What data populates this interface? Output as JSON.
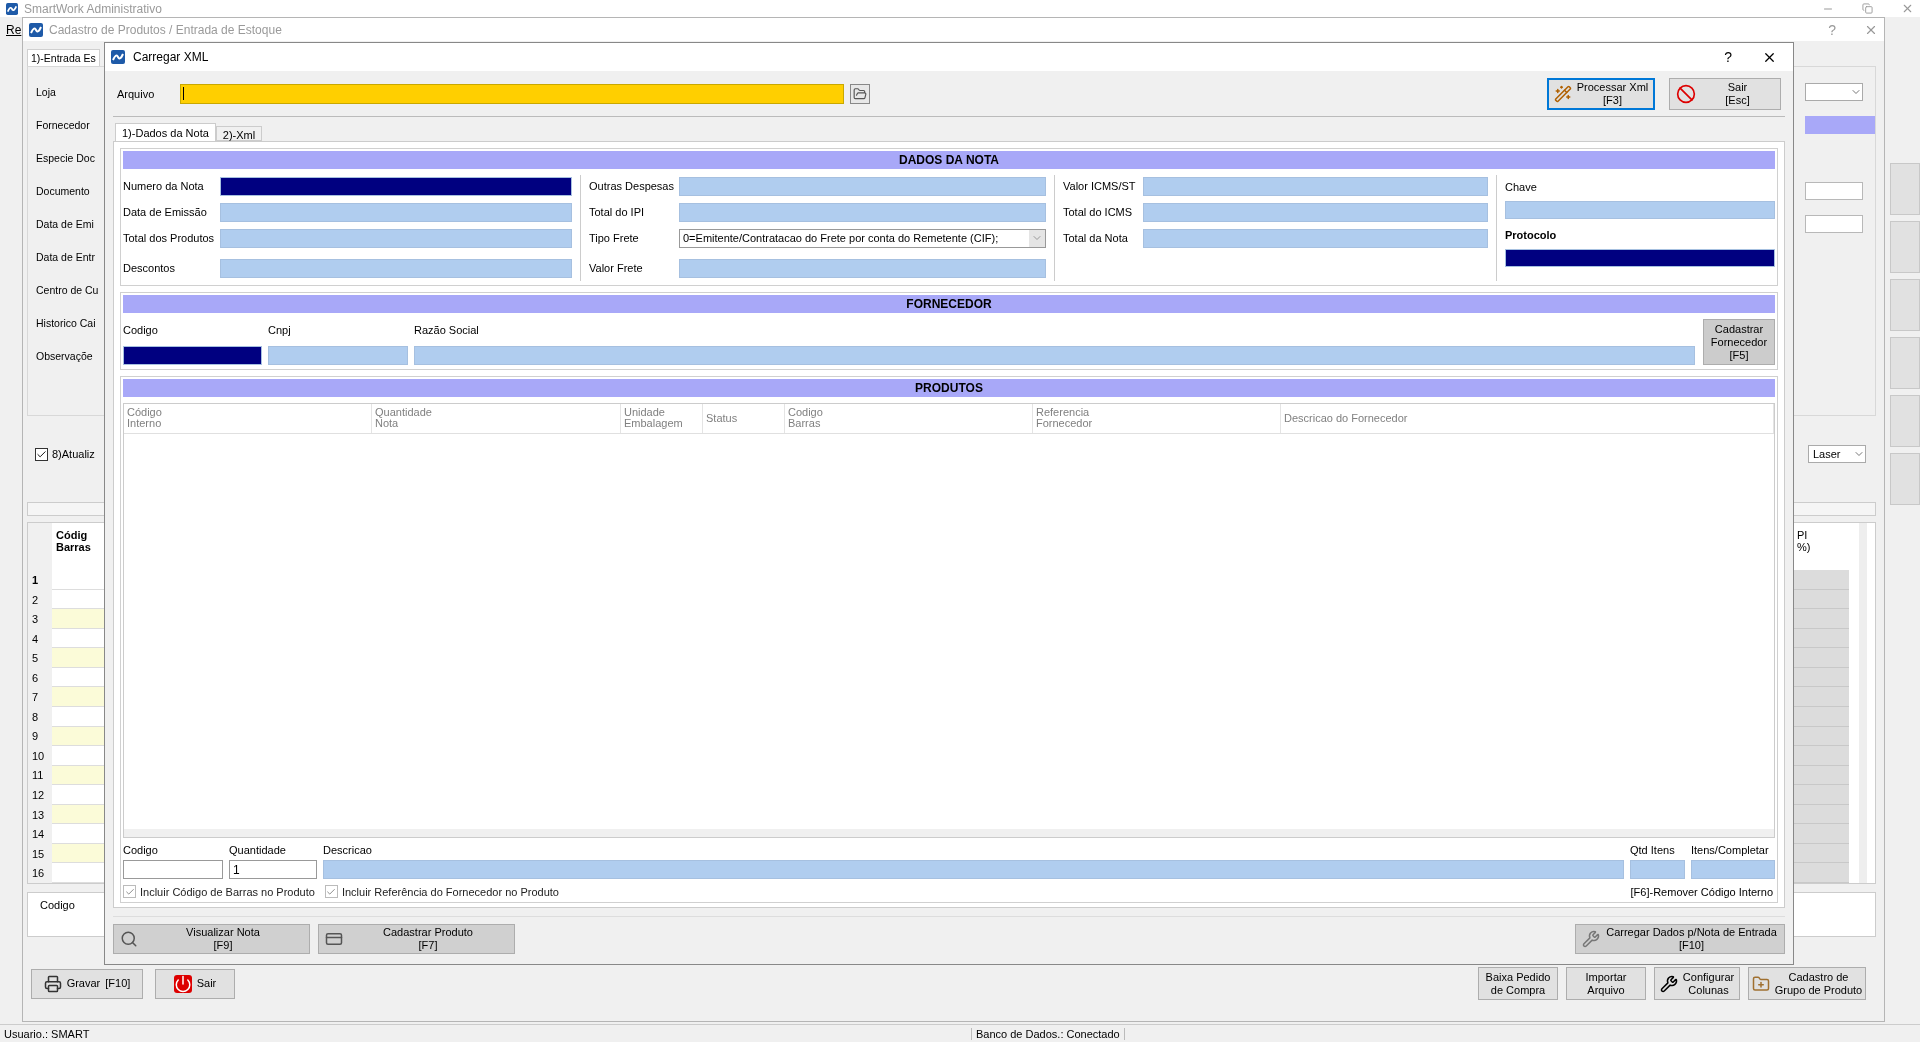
{
  "main_window": {
    "title": "SmartWork Administrativo",
    "menu": [
      "Re"
    ],
    "status_bar": [
      "Usuario.: SMART",
      "Banco de Dados.: Conectado"
    ]
  },
  "cadastro": {
    "title": "Cadastro de Produtos / Entrada de Estoque",
    "help": "?",
    "tab": {
      "label": "1)-Entrada Es",
      "selected": true
    },
    "labels": [
      "Loja",
      "Fornecedor",
      "Especie Doc",
      "Documento",
      "Data de Emi",
      "Data de Entr",
      "Centro de Cu",
      "Historico Cai",
      "Observaçõe"
    ],
    "update_checkbox": {
      "label": "8)Atualiz",
      "checked": true
    },
    "printer_combo": {
      "value": "Laser"
    },
    "grid": {
      "column_1": [
        "Códig",
        "Barras"
      ],
      "column_2": [
        "PI",
        "%)"
      ],
      "rows": [
        {
          "number": "1",
          "selected": true
        },
        {
          "number": "2",
          "selected": false
        },
        {
          "number": "3",
          "selected": false
        },
        {
          "number": "4",
          "selected": false
        },
        {
          "number": "5",
          "selected": false
        },
        {
          "number": "6",
          "selected": false
        },
        {
          "number": "7",
          "selected": false
        },
        {
          "number": "8",
          "selected": false
        },
        {
          "number": "9",
          "selected": false
        },
        {
          "number": "10",
          "selected": false
        },
        {
          "number": "11",
          "selected": false
        },
        {
          "number": "12",
          "selected": false
        },
        {
          "number": "13",
          "selected": false
        },
        {
          "number": "14",
          "selected": false
        },
        {
          "number": "15",
          "selected": false
        },
        {
          "number": "16",
          "selected": false
        }
      ]
    },
    "code_label": "Codigo",
    "buttons": [
      {
        "lines": [
          "Gravar",
          "[F10]"
        ]
      },
      {
        "lines": [
          "Sair"
        ]
      }
    ],
    "right_buttons": [
      {
        "lines": [
          "Baixa Pedido",
          "de Compra"
        ]
      },
      {
        "lines": [
          "Importar",
          "Arquivo"
        ]
      },
      {
        "lines": [
          "Configurar",
          "Colunas"
        ]
      },
      {
        "lines": [
          "Cadastro de",
          "Grupo de Produto"
        ]
      }
    ]
  },
  "dialog": {
    "title": "Carregar XML",
    "help": "?",
    "file_label": "Arquivo",
    "buttons": [
      {
        "lines": [
          "Processar Xml",
          "[F3]"
        ],
        "focused": true
      },
      {
        "lines": [
          "Sair",
          "[Esc]"
        ],
        "focused": false
      }
    ],
    "tabs": [
      {
        "label": "1)-Dados da Nota",
        "selected": true
      },
      {
        "label": "2)-Xml",
        "selected": false
      }
    ],
    "dados": {
      "title": "DADOS DA NOTA",
      "columns": [
        [
          {
            "kind": "field",
            "label": "Numero da Nota",
            "highlighted": true
          },
          {
            "kind": "field",
            "label": "Data de Emissão",
            "highlighted": false
          },
          {
            "kind": "field",
            "label": "Total dos Produtos",
            "highlighted": false
          },
          {
            "kind": "field",
            "label": "Descontos",
            "highlighted": false
          }
        ],
        [
          {
            "kind": "field",
            "label": "Outras Despesas",
            "highlighted": false
          },
          {
            "kind": "field",
            "label": "Total do IPI",
            "highlighted": false
          },
          {
            "kind": "dropdown",
            "label": "Tipo Frete",
            "value": "0=Emitente/Contratacao do Frete por conta do Remetente (CIF);"
          },
          {
            "kind": "field",
            "label": "Valor Frete",
            "highlighted": false
          }
        ],
        [
          {
            "kind": "field",
            "label": "Valor ICMS/ST",
            "highlighted": false
          },
          {
            "kind": "field",
            "label": "Total do ICMS",
            "highlighted": false
          },
          {
            "kind": "field",
            "label": "Total da Nota",
            "highlighted": false
          }
        ]
      ],
      "side": [
        {
          "label": "Chave",
          "bold": false,
          "highlighted": false
        },
        {
          "label": "Protocolo",
          "bold": true,
          "highlighted": true
        }
      ]
    },
    "fornecedor": {
      "title": "FORNECEDOR",
      "fields": [
        {
          "label": "Codigo",
          "highlighted": true
        },
        {
          "label": "Cnpj",
          "highlighted": false
        },
        {
          "label": "Razão Social",
          "highlighted": false
        }
      ],
      "button": [
        "Cadastrar",
        "Fornecedor",
        "[F5]"
      ]
    },
    "produtos": {
      "title": "PRODUTOS",
      "columns": [
        [
          "Código",
          "Interno"
        ],
        [
          "Quantidade",
          "Nota"
        ],
        [
          "Unidade",
          "Embalagem"
        ],
        [
          "Status"
        ],
        [
          "Codigo",
          "Barras"
        ],
        [
          "Referencia",
          "Fornecedor"
        ],
        [
          "Descricao do Fornecedor"
        ]
      ],
      "entry": [
        {
          "kind": "input",
          "label": "Codigo"
        },
        {
          "kind": "input",
          "label": "Quantidade",
          "value": "1"
        },
        {
          "kind": "readonly",
          "label": "Descricao"
        },
        {
          "kind": "readonly",
          "label": "Qtd Itens"
        },
        {
          "kind": "readonly",
          "label": "Itens/Completar"
        }
      ],
      "checkboxes": [
        {
          "label": "Incluir Código de Barras no Produto",
          "checked": true,
          "disabled": true
        },
        {
          "label": "Incluir Referência do Fornecedor no Produto",
          "checked": true,
          "disabled": true
        }
      ],
      "hint": "[F6]-Remover Código Interno"
    },
    "footer_buttons": [
      {
        "lines": [
          "Visualizar Nota",
          "[F9]"
        ]
      },
      {
        "lines": [
          "Cadastrar Produto",
          "[F7]"
        ]
      },
      {
        "lines": [
          "Carregar Dados p/Nota de Entrada",
          "[F10]"
        ]
      }
    ]
  }
}
